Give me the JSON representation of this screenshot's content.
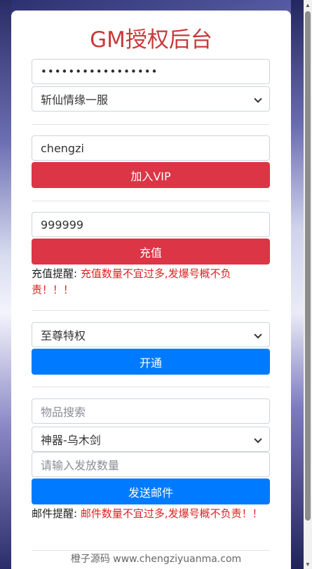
{
  "title": "GM授权后台",
  "login": {
    "password_mask": "•••••••••••••••••",
    "server_select": "斩仙情缘一服"
  },
  "vip": {
    "username": "chengzi",
    "button": "加入VIP"
  },
  "recharge": {
    "amount": "999999",
    "button": "充值",
    "reminder_label": "充值提醒:",
    "reminder_text": "充值数量不宜过多,发爆号概不负责！！！"
  },
  "privilege": {
    "select": "至尊特权",
    "button": "开通"
  },
  "mail": {
    "search_placeholder": "物品搜索",
    "item_select": "神器-乌木剑",
    "quantity_placeholder": "请输入发放数量",
    "button": "发送邮件",
    "reminder_label": "邮件提醒:",
    "reminder_text": "邮件数量不宜过多,发爆号概不负责！！"
  },
  "footer": "橙子源码 www.chengziyuanma.com",
  "colors": {
    "title": "#c83a3a",
    "danger": "#dc3545",
    "primary": "#007bff",
    "warning_text": "#e02020"
  }
}
